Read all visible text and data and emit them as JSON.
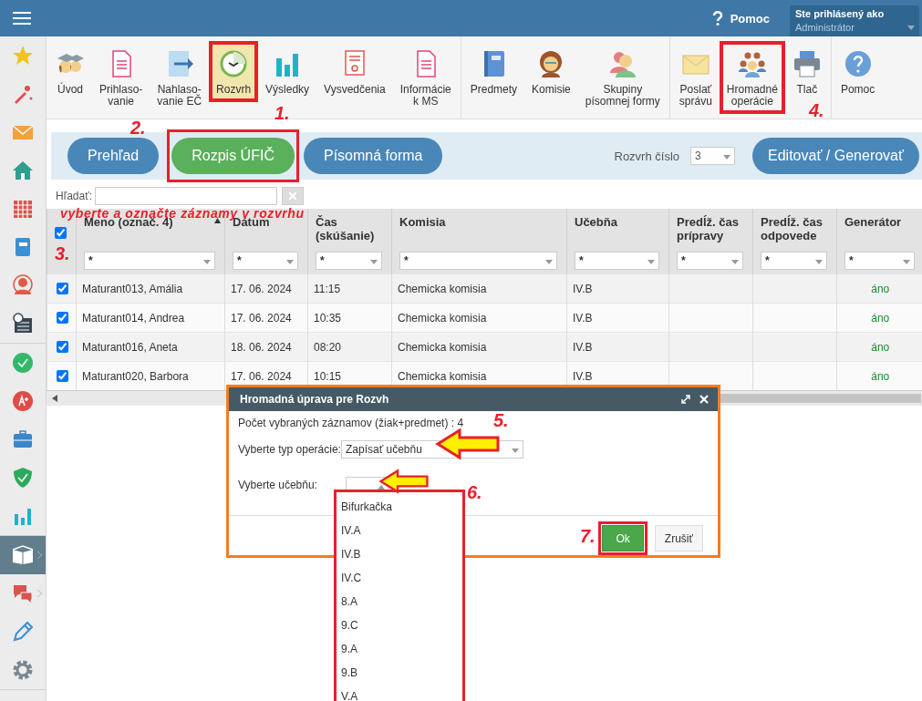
{
  "top_bar": {
    "help": "Pomoc",
    "user_caption": "Ste prihlásený ako",
    "user_name": "Administrátor"
  },
  "sidebar": {
    "groups": [
      [
        {
          "selected": false,
          "submenu": false
        },
        {
          "selected": false,
          "submenu": false
        },
        {
          "selected": false,
          "submenu": false
        },
        {
          "selected": false,
          "submenu": false
        },
        {
          "selected": false,
          "submenu": false
        },
        {
          "selected": false,
          "submenu": false
        },
        {
          "selected": false,
          "submenu": false
        },
        {
          "selected": false,
          "submenu": false
        }
      ],
      [
        {
          "selected": false,
          "submenu": false
        },
        {
          "selected": false,
          "submenu": false
        },
        {
          "selected": false,
          "submenu": false
        },
        {
          "selected": false,
          "submenu": false
        },
        {
          "selected": false,
          "submenu": false
        }
      ],
      [
        {
          "selected": true,
          "submenu": true
        },
        {
          "selected": false,
          "submenu": true
        },
        {
          "selected": false,
          "submenu": false
        },
        {
          "selected": false,
          "submenu": false
        }
      ]
    ]
  },
  "toolbar": {
    "groups": [
      [
        {
          "label": "Úvod",
          "selected": false,
          "highlighted": false
        },
        {
          "label": "Prihlaso-\nvanie",
          "selected": false,
          "highlighted": false
        },
        {
          "label": "Nahlaso-\nvanie EČ",
          "selected": false,
          "highlighted": false
        },
        {
          "label": "Rozvrh",
          "selected": true,
          "highlighted": true
        },
        {
          "label": "Výsledky",
          "selected": false,
          "highlighted": false
        },
        {
          "label": "Vysvedčenia",
          "selected": false,
          "highlighted": false
        },
        {
          "label": "Informácie\nk MS",
          "selected": false,
          "highlighted": false
        }
      ],
      [
        {
          "label": "Predmety",
          "selected": false,
          "highlighted": false
        },
        {
          "label": "Komisie",
          "selected": false,
          "highlighted": false
        },
        {
          "label": "Skupiny\npísomnej formy",
          "selected": false,
          "highlighted": false
        }
      ],
      [
        {
          "label": "Poslať\nsprávu",
          "selected": false,
          "highlighted": false
        },
        {
          "label": "Hromadné\noperácie",
          "selected": false,
          "highlighted": true
        },
        {
          "label": "Tlač",
          "selected": false,
          "highlighted": false
        }
      ],
      [
        {
          "label": "Pomoc",
          "selected": false,
          "highlighted": false
        }
      ]
    ]
  },
  "tabs": [
    {
      "label": "Prehľad",
      "selected": false,
      "highlighted": false
    },
    {
      "label": "Rozpis ÚFIČ",
      "selected": true,
      "highlighted": true
    },
    {
      "label": "Písomná forma",
      "selected": false,
      "highlighted": false
    }
  ],
  "schedule_number": {
    "label": "Rozvrh číslo",
    "value": "3"
  },
  "edit_button": "Editovať / Generovať",
  "search": {
    "label": "Hľadať:"
  },
  "table": {
    "select_all": true,
    "columns": [
      {
        "label": "Meno (označ. 4)",
        "sorted": true,
        "filter": "*"
      },
      {
        "label": "Dátum",
        "filter": "*"
      },
      {
        "label": "Čas\n(skúšanie)",
        "filter": "*"
      },
      {
        "label": "Komisia",
        "filter": "*"
      },
      {
        "label": "Učebňa",
        "filter": "*"
      },
      {
        "label": "Predĺž. čas\nprípravy",
        "filter": "*"
      },
      {
        "label": "Predĺž. čas\nodpovede",
        "filter": "*"
      },
      {
        "label": "Generátor",
        "filter": "*"
      }
    ],
    "rows": [
      {
        "checked": true,
        "cells": [
          "Maturant013, Amália",
          "17. 06. 2024",
          "11:15",
          "Chemicka komisia",
          "IV.B",
          null,
          null,
          "áno"
        ]
      },
      {
        "checked": true,
        "cells": [
          "Maturant014, Andrea",
          "17. 06. 2024",
          "10:35",
          "Chemicka komisia",
          "IV.B",
          null,
          null,
          "áno"
        ]
      },
      {
        "checked": true,
        "cells": [
          "Maturant016, Aneta",
          "18. 06. 2024",
          "08:20",
          "Chemicka komisia",
          "IV.B",
          null,
          null,
          "áno"
        ]
      },
      {
        "checked": true,
        "cells": [
          "Maturant020, Barbora",
          "17. 06. 2024",
          "10:15",
          "Chemicka komisia",
          "IV.B",
          null,
          null,
          "áno"
        ]
      }
    ]
  },
  "dialog": {
    "title": "Hromadná úprava pre Rozvh",
    "count_text": "Počet vybraných záznamov (žiak+predmet) : 4",
    "fields": [
      {
        "label": "Vyberte typ operácie:",
        "value": "Zapísať učebňu",
        "expanded": false
      },
      {
        "label": "Vyberte učebňu:",
        "expanded": true,
        "highlighted": true,
        "options": [
          "Bifurkačka",
          "IV.A",
          "IV.B",
          "IV.C",
          "8.A",
          "9.C",
          "9.A",
          "9.B",
          "V.A"
        ]
      }
    ],
    "buttons": [
      {
        "label": "Ok",
        "kind": "primary",
        "highlighted": true
      },
      {
        "label": "Zrušiť",
        "kind": "default",
        "highlighted": false
      }
    ]
  },
  "annotations": {
    "caption": "vyberte a označte záznamy v rozvrhu",
    "steps": [
      "1.",
      "2.",
      "3.",
      "4.",
      "5.",
      "6.",
      "7."
    ]
  }
}
